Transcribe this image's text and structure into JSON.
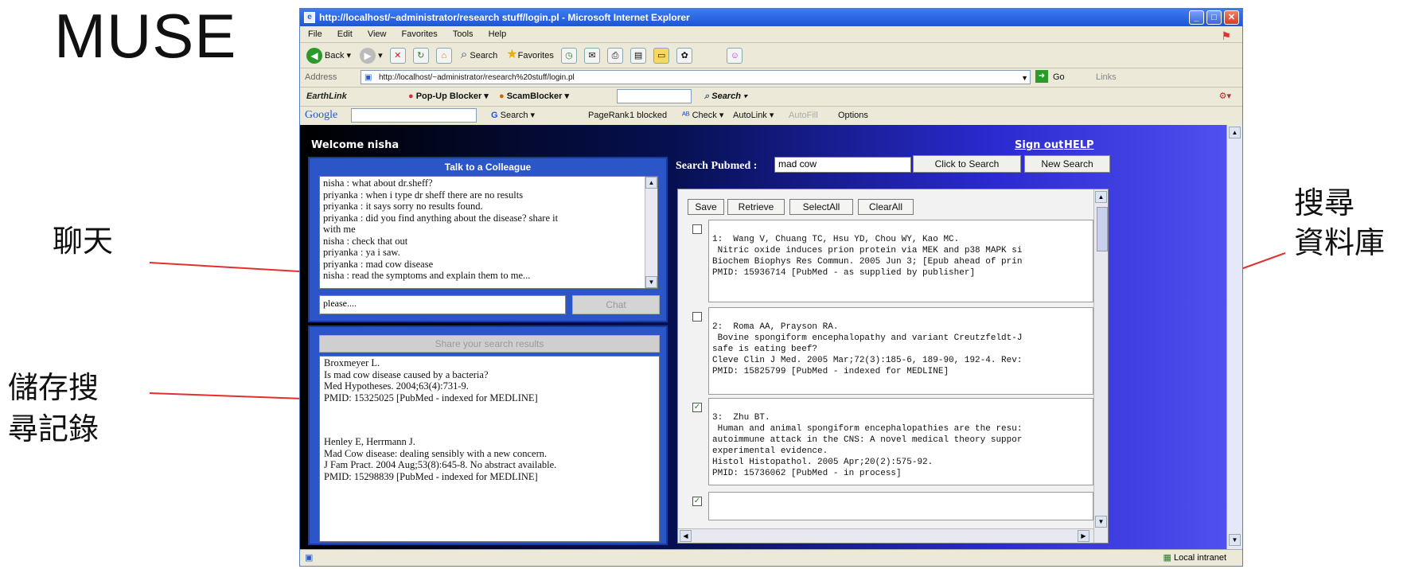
{
  "slide": {
    "title": "MUSE",
    "labels": {
      "chat": "聊天",
      "saved_line1": "儲存搜",
      "saved_line2": "尋記錄",
      "search_line1": "搜尋",
      "search_line2": "資料庫"
    },
    "arrow_color": "#e23030"
  },
  "browser": {
    "title": "http://localhost/~administrator/research stuff/login.pl - Microsoft Internet Explorer",
    "menu": [
      "File",
      "Edit",
      "View",
      "Favorites",
      "Tools",
      "Help"
    ],
    "toolbar": {
      "back": "Back",
      "search": "Search",
      "favorites": "Favorites"
    },
    "address": {
      "label": "Address",
      "url": "http://localhost/~administrator/research%20stuff/login.pl",
      "go": "Go",
      "links": "Links"
    },
    "earthlink": {
      "brand": "EarthLink",
      "popup": "Pop-Up Blocker",
      "scam": "ScamBlocker",
      "search": "Search"
    },
    "google": {
      "brand": "Google",
      "search": "Search",
      "pagerank": "PageRank",
      "blocked": "1 blocked",
      "check": "Check",
      "autolink": "AutoLink",
      "autofill": "AutoFill",
      "options": "Options"
    },
    "status": {
      "zone": "Local intranet"
    }
  },
  "page": {
    "welcome": "Welcome nisha",
    "sign_out": "Sign out",
    "help": "HELP",
    "chat": {
      "title": "Talk to a Colleague",
      "messages": [
        "nisha  : what about dr.sheff?",
        "priyanka  : when i type dr sheff there are no results",
        "priyanka  : it says sorry no results found.",
        "priyanka  : did you find anything about the disease? share it",
        "with me",
        "nisha  : check that out",
        "priyanka  : ya i saw.",
        "priyanka  : mad cow disease",
        "nisha  : read the symptoms and explain them to me..."
      ],
      "input_value": "please....",
      "send_button": "Chat"
    },
    "saved": {
      "share_button": "Share your search results",
      "lines": [
        "Broxmeyer L.",
        " Is mad cow disease caused by a bacteria?",
        "Med Hypotheses. 2004;63(4):731-9.",
        "PMID: 15325025 [PubMed - indexed for MEDLINE]",
        "",
        "",
        "Henley E, Herrmann J.",
        " Mad Cow disease: dealing sensibly with a new concern.",
        "J Fam Pract. 2004 Aug;53(8):645-8. No abstract available.",
        "PMID: 15298839 [PubMed - indexed for MEDLINE]"
      ]
    },
    "search": {
      "label": "Search Pubmed :",
      "query": "mad cow",
      "search_button": "Click to Search",
      "new_button": "New Search",
      "actions": [
        "Save",
        "Retrieve",
        "SelectAll",
        "ClearAll"
      ],
      "results": [
        {
          "checked": false,
          "text": "\n1:  Wang V, Chuang TC, Hsu YD, Chou WY, Kao MC.\n Nitric oxide induces prion protein via MEK and p38 MAPK si\nBiochem Biophys Res Commun. 2005 Jun 3; [Epub ahead of prin\nPMID: 15936714 [PubMed - as supplied by publisher]"
        },
        {
          "checked": false,
          "text": "\n2:  Roma AA, Prayson RA.\n Bovine spongiform encephalopathy and variant Creutzfeldt-J\nsafe is eating beef?\nCleve Clin J Med. 2005 Mar;72(3):185-6, 189-90, 192-4. Rev:\nPMID: 15825799 [PubMed - indexed for MEDLINE]"
        },
        {
          "checked": true,
          "text": "\n3:  Zhu BT.\n Human and animal spongiform encephalopathies are the resu:\nautoimmune attack in the CNS: A novel medical theory suppor\nexperimental evidence.\nHistol Histopathol. 2005 Apr;20(2):575-92.\nPMID: 15736062 [PubMed - in process]"
        },
        {
          "checked": true,
          "text": ""
        }
      ]
    }
  }
}
